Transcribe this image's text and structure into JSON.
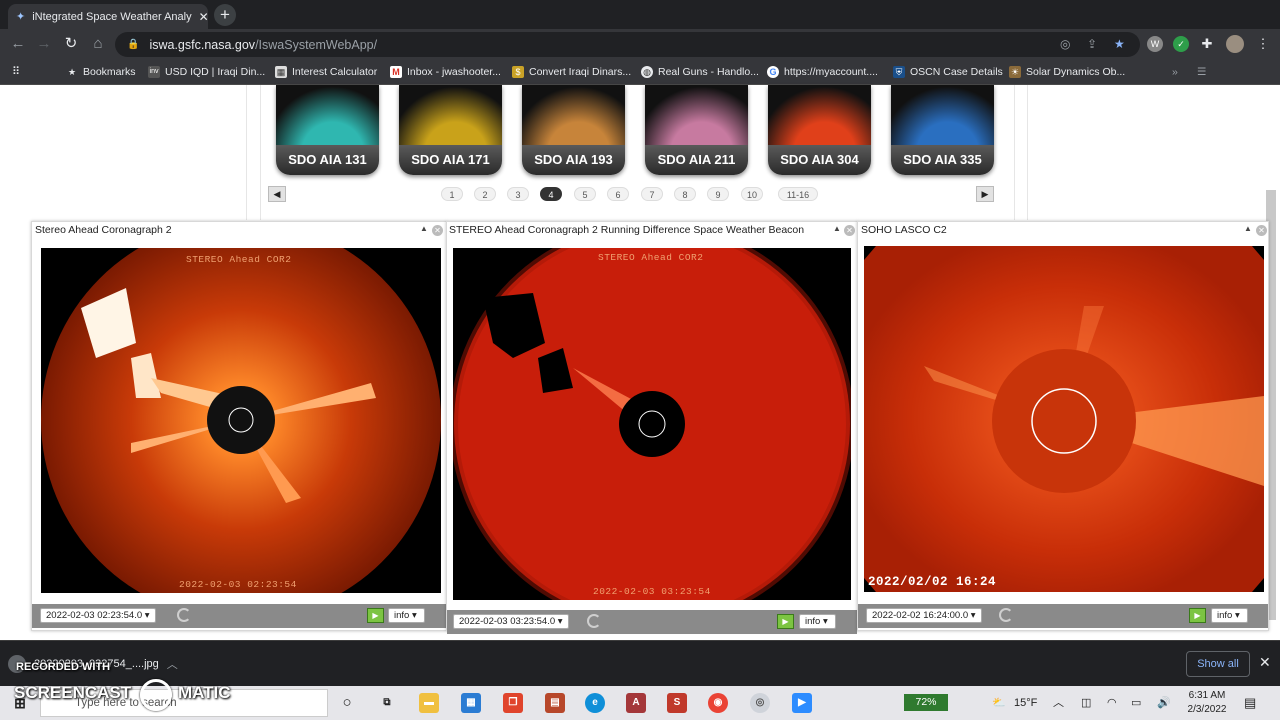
{
  "browser": {
    "tab_title": "iNtegrated Space Weather Analy",
    "new_tab": "+",
    "url_host": "iswa.gsfc.nasa.gov",
    "url_path": "/IswaSystemWebApp/",
    "bookmarks": [
      {
        "label": "Bookmarks",
        "icon": "star-icon"
      },
      {
        "label": "USD IQD | Iraqi Din...",
        "icon": "inv-favicon"
      },
      {
        "label": "Interest Calculator",
        "icon": "calculator-favicon"
      },
      {
        "label": "Inbox - jwashooter...",
        "icon": "gmail-icon"
      },
      {
        "label": "Convert Iraqi Dinars...",
        "icon": "converter-favicon"
      },
      {
        "label": "Real Guns - Handlo...",
        "icon": "globe-icon"
      },
      {
        "label": "https://myaccount....",
        "icon": "google-icon"
      },
      {
        "label": "OSCN Case Details",
        "icon": "oscn-favicon"
      },
      {
        "label": "Solar Dynamics Ob...",
        "icon": "sdo-favicon"
      }
    ]
  },
  "thumbnails": [
    {
      "label": "SDO AIA 131",
      "color": "#2fb7b0"
    },
    {
      "label": "SDO AIA 171",
      "color": "#c9a21a"
    },
    {
      "label": "SDO AIA 193",
      "color": "#c7843a"
    },
    {
      "label": "SDO AIA 211",
      "color": "#c77aa0"
    },
    {
      "label": "SDO AIA 304",
      "color": "#e0401a"
    },
    {
      "label": "SDO AIA 335",
      "color": "#2a6fc0"
    }
  ],
  "pager": {
    "pages": [
      "1",
      "2",
      "3",
      "4",
      "5",
      "6",
      "7",
      "8",
      "9",
      "10",
      "11-16"
    ],
    "active": "4"
  },
  "panels": [
    {
      "title": "Stereo Ahead Coronagraph 2",
      "header": "STEREO Ahead COR2",
      "stamp": "2022-02-03  02:23:54",
      "date": "2022-02-03 02:23:54.0",
      "info": "info"
    },
    {
      "title": "STEREO Ahead Coronagraph 2 Running Difference Space Weather Beacon",
      "header": "STEREO Ahead COR2",
      "stamp": "2022-02-03  03:23:54",
      "date": "2022-02-03 03:23:54.0",
      "info": "info"
    },
    {
      "title": "SOHO LASCO C2",
      "stamp": "2022/02/02 16:24",
      "date": "2022-02-02 16:24:00.0",
      "info": "info"
    }
  ],
  "download": {
    "file": "20220203_032754_....jpg",
    "show_all": "Show all",
    "close": "✕"
  },
  "taskbar": {
    "search_placeholder": "Type here to search",
    "battery": "72%",
    "temperature": "15°F",
    "time": "6:31 AM",
    "date": "2/3/2022"
  },
  "watermark": {
    "line1": "RECORDED WITH",
    "line2": "SCREENCAST",
    "line3": "MATIC"
  }
}
